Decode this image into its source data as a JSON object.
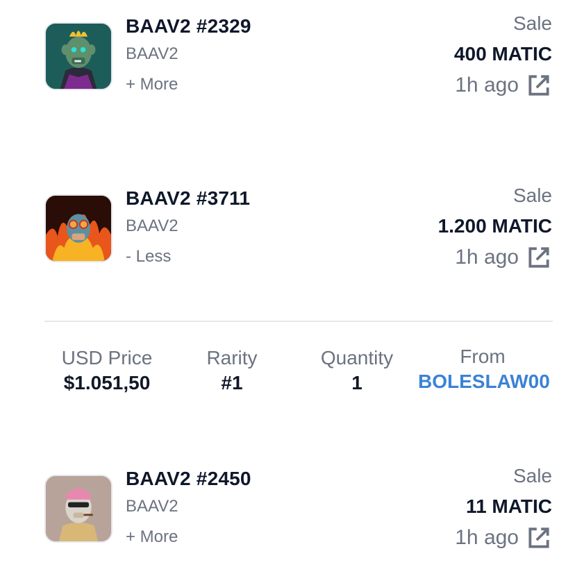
{
  "activity": [
    {
      "name": "BAAV2 #2329",
      "collection": "BAAV2",
      "toggle_label": "+ More",
      "event": "Sale",
      "price": "400 MATIC",
      "time": "1h ago"
    },
    {
      "name": "BAAV2 #3711",
      "collection": "BAAV2",
      "toggle_label": "- Less",
      "event": "Sale",
      "price": "1.200 MATIC",
      "time": "1h ago",
      "details": {
        "usd_price_label": "USD Price",
        "usd_price_value": "$1.051,50",
        "rarity_label": "Rarity",
        "rarity_value": "#1",
        "quantity_label": "Quantity",
        "quantity_value": "1",
        "from_label": "From",
        "from_value": "BOLESLAW00"
      }
    },
    {
      "name": "BAAV2 #2450",
      "collection": "BAAV2",
      "toggle_label": "+ More",
      "event": "Sale",
      "price": "11 MATIC",
      "time": "1h ago"
    }
  ],
  "colors": {
    "link": "#3b82d6",
    "muted": "#6b7280",
    "text": "#0f172a"
  },
  "icons": {
    "external_link": "external-link-icon"
  }
}
